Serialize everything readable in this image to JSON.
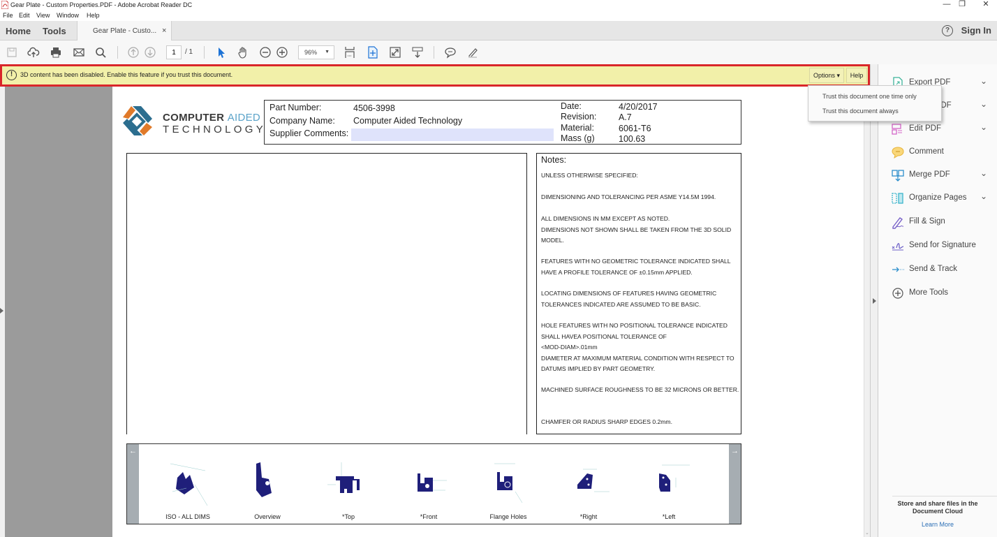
{
  "window": {
    "title": "Gear Plate - Custom Properties.PDF - Adobe Acrobat Reader DC",
    "controls": {
      "minimize": "—",
      "restore": "❐",
      "close": "✕"
    }
  },
  "menu": [
    "File",
    "Edit",
    "View",
    "Window",
    "Help"
  ],
  "tabs": {
    "home": "Home",
    "tools": "Tools",
    "document": "Gear Plate - Custo...",
    "close": "×",
    "help_icon": "?",
    "sign_in": "Sign In"
  },
  "toolbar": {
    "icons": [
      "save-icon",
      "upload-cloud-icon",
      "print-icon",
      "email-icon",
      "search-icon",
      "page-up-icon",
      "page-down-icon",
      "select-pointer-icon",
      "hand-icon",
      "zoom-out-icon",
      "zoom-in-icon",
      "fit-page-icon",
      "3d-view-icon",
      "full-screen-icon",
      "scroll-mode-icon",
      "comment-icon",
      "highlight-pen-icon"
    ],
    "page_current": "1",
    "page_total": "/ 1",
    "zoom": "96%"
  },
  "notification": {
    "message": "3D content has been disabled. Enable this feature if you trust this document.",
    "options_label": "Options ▾",
    "help_label": "Help",
    "border_color": "#d9262a",
    "background_color": "#f2f0a9"
  },
  "options_menu": [
    "Trust this document one time only",
    "Trust this document always"
  ],
  "right_pane": {
    "tools": [
      {
        "label": "Export PDF",
        "icon": "export-pdf-icon",
        "chevron": true
      },
      {
        "label": "Create PDF",
        "icon": "create-pdf-icon",
        "chevron": true
      },
      {
        "label": "Edit PDF",
        "icon": "edit-pdf-icon",
        "chevron": true
      },
      {
        "label": "Comment",
        "icon": "comment-icon",
        "chevron": false
      },
      {
        "label": "Merge PDF",
        "icon": "merge-pdf-icon",
        "chevron": true
      },
      {
        "label": "Organize Pages",
        "icon": "organize-pages-icon",
        "chevron": true
      },
      {
        "label": "Fill & Sign",
        "icon": "fill-sign-icon",
        "chevron": false
      },
      {
        "label": "Send for Signature",
        "icon": "send-signature-icon",
        "chevron": false
      },
      {
        "label": "Send & Track",
        "icon": "send-track-icon",
        "chevron": false
      },
      {
        "label": "More Tools",
        "icon": "more-tools-icon",
        "chevron": false
      }
    ],
    "cloud_text_1": "Store and share files in the",
    "cloud_text_2": "Document Cloud",
    "learn_more": "Learn More"
  },
  "document": {
    "logo_line1_bold": "COMPUTER",
    "logo_line1_light": "AIDED",
    "logo_line2": "TECHNOLOGY",
    "fields": {
      "part_number_label": "Part Number:",
      "part_number": "4506-3998",
      "company_label": "Company Name:",
      "company": "Computer Aided Technology",
      "supplier_label": "Supplier Comments:",
      "supplier_comments": "",
      "date_label": "Date:",
      "date": "4/20/2017",
      "revision_label": "Revision:",
      "revision": "A.7",
      "material_label": "Material:",
      "material": "6061-T6",
      "mass_label": "Mass (g)",
      "mass": "100.63"
    },
    "notes_title": "Notes:",
    "notes": [
      "UNLESS OTHERWISE SPECIFIED:",
      "DIMENSIONING AND TOLERANCING PER ASME Y14.5M 1994.",
      "ALL DIMENSIONS IN MM EXCEPT AS NOTED.\nDIMENSIONS NOT SHOWN SHALL BE TAKEN FROM THE 3D SOLID MODEL.",
      "FEATURES WITH NO GEOMETRIC TOLERANCE INDICATED SHALL HAVE A PROFILE TOLERANCE OF ±0.15mm APPLIED.",
      "LOCATING DIMENSIONS OF FEATURES HAVING GEOMETRIC TOLERANCES INDICATED ARE ASSUMED TO BE BASIC.",
      "HOLE FEATURES WITH NO POSITIONAL TOLERANCE INDICATED SHALL HAVEA POSITIONAL TOLERANCE OF\n<MOD-DIAM>.01mm\nDIAMETER AT MAXIMUM MATERIAL CONDITION WITH RESPECT TO DATUMS IMPLIED BY PART GEOMETRY.",
      "MACHINED SURFACE ROUGHNESS TO BE 32 MICRONS OR BETTER.",
      "CHAMFER OR RADIUS SHARP EDGES 0.2mm."
    ],
    "views": [
      "ISO - ALL DIMS",
      "Overview",
      "*Top",
      "*Front",
      "Flange Holes",
      "*Right",
      "*Left"
    ],
    "views_nav_prev": "←",
    "views_nav_next": "→"
  }
}
